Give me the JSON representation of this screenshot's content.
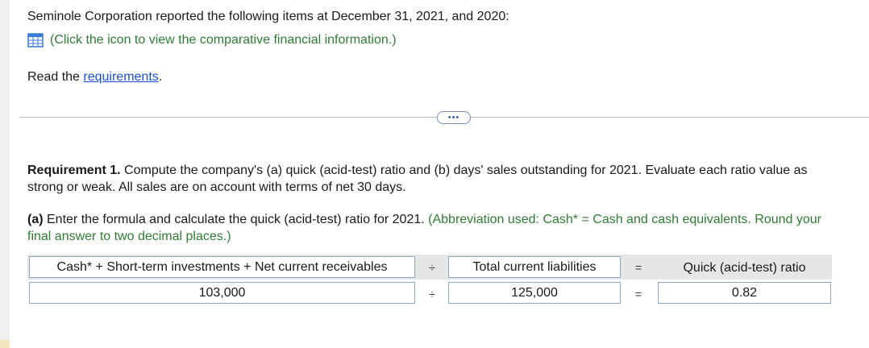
{
  "intro": {
    "statement": "Seminole Corporation reported the following items at December 31, 2021, and 2020:",
    "icon_link_text": "(Click the icon to view the comparative financial information.)",
    "icon": "table-grid-icon",
    "read_prefix": "Read the ",
    "requirements_link": "requirements",
    "read_suffix": "."
  },
  "more_button": "•••",
  "requirement": {
    "label": "Requirement 1.",
    "text": " Compute the company's (a) quick (acid-test) ratio and (b) days' sales outstanding for 2021. Evaluate each ratio value as",
    "text_line2": "strong or weak. All sales are on account with terms of net 30 days."
  },
  "part_a": {
    "label": "(a)",
    "text": " Enter the formula and calculate the quick (acid-test) ratio for 2021. ",
    "hint": "(Abbreviation used: Cash* = Cash and cash equivalents. Round your",
    "hint_line2": "final answer to two decimal places.)"
  },
  "formula": {
    "numerator_label": "Cash* + Short-term investments + Net current receivables",
    "divide_symbol": "÷",
    "denominator_label": "Total current liabilities",
    "equals_symbol": "=",
    "result_label": "Quick (acid-test) ratio",
    "numerator_value": "103,000",
    "denominator_value": "125,000",
    "result_value": "0.82"
  },
  "colors": {
    "hint_green": "#2e7d32",
    "link_blue": "#1a4fd6",
    "cell_border": "#8aa7c4",
    "header_band": "#e6e6e6"
  }
}
